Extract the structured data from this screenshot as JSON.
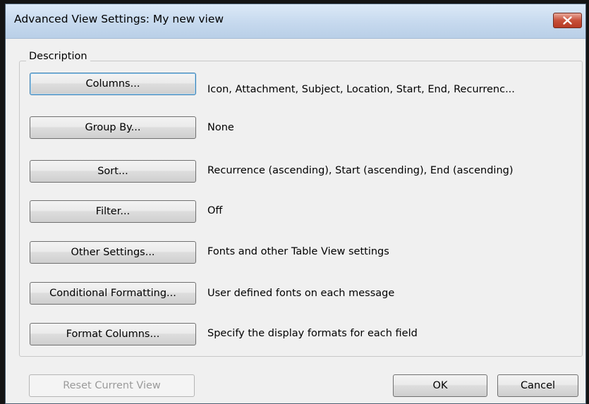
{
  "window": {
    "title": "Advanced View Settings: My new view",
    "close_icon": "close-icon"
  },
  "group": {
    "legend": "Description"
  },
  "rows": [
    {
      "button": "Columns...",
      "value": "Icon, Attachment, Subject, Location, Start, End, Recurrenc..."
    },
    {
      "button": "Group By...",
      "value": "None"
    },
    {
      "button": "Sort...",
      "value": "Recurrence (ascending), Start (ascending), End (ascending)"
    },
    {
      "button": "Filter...",
      "value": "Off"
    },
    {
      "button": "Other Settings...",
      "value": "Fonts and other Table View settings"
    },
    {
      "button": "Conditional Formatting...",
      "value": "User defined fonts on each message"
    },
    {
      "button": "Format Columns...",
      "value": "Specify the display formats for each field"
    }
  ],
  "footer": {
    "reset_label": "Reset Current View",
    "ok_label": "OK",
    "cancel_label": "Cancel"
  },
  "colors": {
    "titlebar": "#c6d9ee",
    "close_button": "#c7503a",
    "dialog_bg": "#f0f0f0"
  }
}
